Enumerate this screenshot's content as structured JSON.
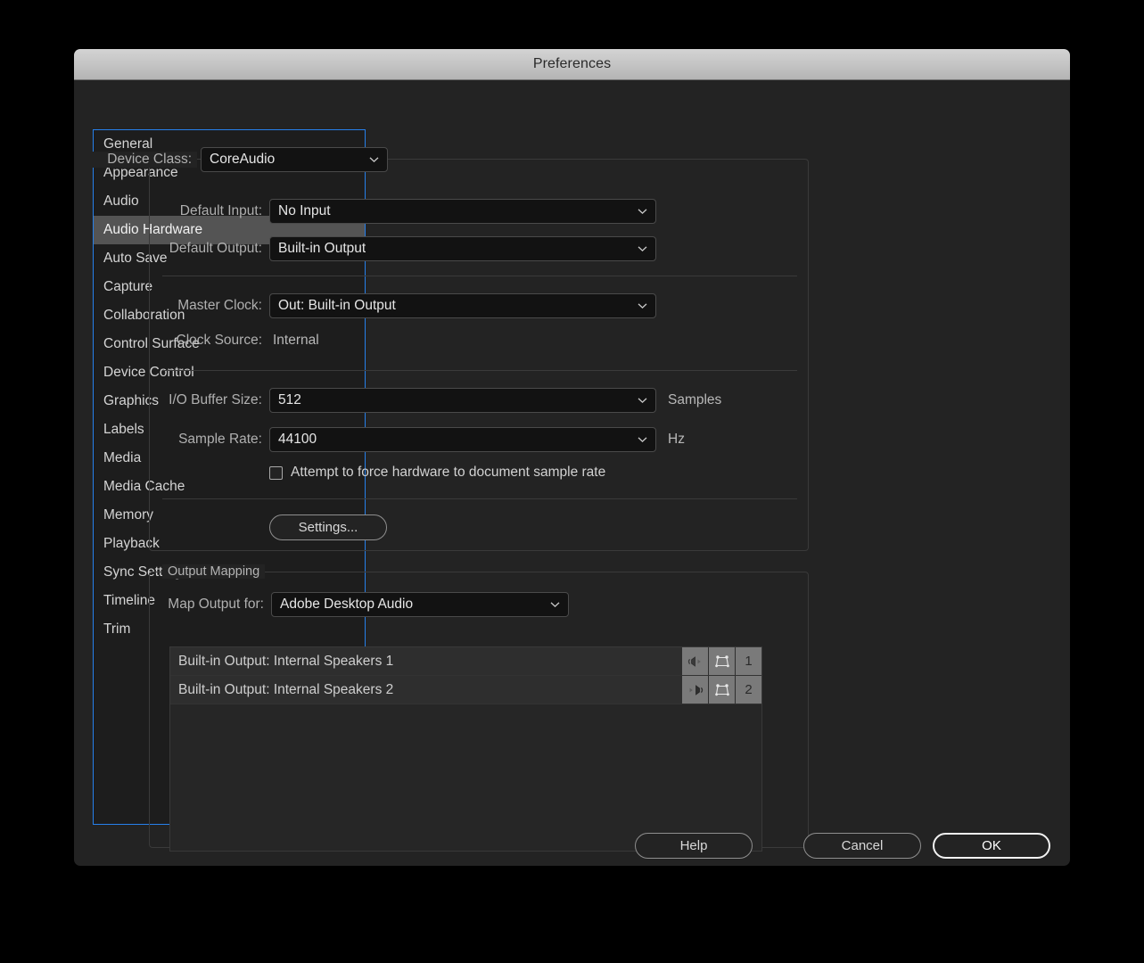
{
  "window": {
    "title": "Preferences"
  },
  "sidebar": {
    "items": [
      {
        "label": "General",
        "selected": false
      },
      {
        "label": "Appearance",
        "selected": false
      },
      {
        "label": "Audio",
        "selected": false
      },
      {
        "label": "Audio Hardware",
        "selected": true
      },
      {
        "label": "Auto Save",
        "selected": false
      },
      {
        "label": "Capture",
        "selected": false
      },
      {
        "label": "Collaboration",
        "selected": false
      },
      {
        "label": "Control Surface",
        "selected": false
      },
      {
        "label": "Device Control",
        "selected": false
      },
      {
        "label": "Graphics",
        "selected": false
      },
      {
        "label": "Labels",
        "selected": false
      },
      {
        "label": "Media",
        "selected": false
      },
      {
        "label": "Media Cache",
        "selected": false
      },
      {
        "label": "Memory",
        "selected": false
      },
      {
        "label": "Playback",
        "selected": false
      },
      {
        "label": "Sync Settings",
        "selected": false
      },
      {
        "label": "Timeline",
        "selected": false
      },
      {
        "label": "Trim",
        "selected": false
      }
    ]
  },
  "device_group": {
    "device_class_label": "Device Class:",
    "device_class_value": "CoreAudio",
    "default_input_label": "Default Input:",
    "default_input_value": "No Input",
    "default_output_label": "Default Output:",
    "default_output_value": "Built-in Output",
    "master_clock_label": "Master Clock:",
    "master_clock_value": "Out: Built-in Output",
    "clock_source_label": "Clock Source:",
    "clock_source_value": "Internal",
    "buffer_size_label": "I/O Buffer Size:",
    "buffer_size_value": "512",
    "buffer_size_units": "Samples",
    "sample_rate_label": "Sample Rate:",
    "sample_rate_value": "44100",
    "sample_rate_units": "Hz",
    "force_hw_checkbox_label": "Attempt to force hardware to document sample rate",
    "force_hw_checked": false,
    "settings_button": "Settings..."
  },
  "output_mapping": {
    "group_label": "Output Mapping",
    "map_output_for_label": "Map Output for:",
    "map_output_for_value": "Adobe Desktop Audio",
    "rows": [
      {
        "name": "Built-in Output: Internal Speakers 1",
        "speaker_icon": "speaker-left-icon",
        "pan_icon": "pan-field-icon",
        "channel": "1"
      },
      {
        "name": "Built-in Output: Internal Speakers 2",
        "speaker_icon": "speaker-right-icon",
        "pan_icon": "pan-field-icon",
        "channel": "2"
      }
    ]
  },
  "footer": {
    "help_label": "Help",
    "cancel_label": "Cancel",
    "ok_label": "OK"
  },
  "colors": {
    "dialog_bg": "#232323",
    "titlebar_bg": "#c3c3c3",
    "focus_blue": "#2680eb",
    "selected_row": "#545454",
    "combo_bg": "#121212",
    "chan_btn": "#7a7a7a"
  }
}
